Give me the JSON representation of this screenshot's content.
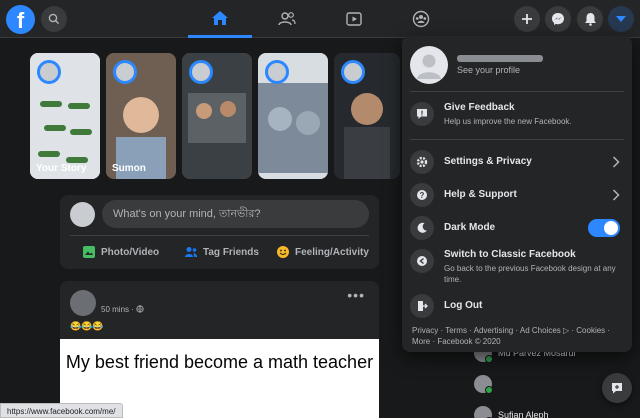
{
  "topbar": {
    "logo_letter": "f"
  },
  "stories": [
    {
      "label": "Your Story",
      "bg": "#e9ebee"
    },
    {
      "label": "Sumon",
      "bg": "#7a6a5a"
    },
    {
      "label": "",
      "bg": "#4a4f55"
    },
    {
      "label": "",
      "bg": "#6b7a8a"
    },
    {
      "label": "",
      "bg": "#2b2e33"
    }
  ],
  "composer": {
    "placeholder": "What's on your mind, তানভীর?",
    "photo_video": "Photo/Video",
    "tag_friends": "Tag Friends",
    "feeling_activity": "Feeling/Activity"
  },
  "post": {
    "time": "50 mins ·",
    "emoji": "😂😂😂",
    "image_text": "My best friend become a math teacher"
  },
  "contacts": [
    {
      "name": "Md Parvez Mosarul"
    },
    {
      "name": ""
    },
    {
      "name": "Sufian Aleph"
    }
  ],
  "menu": {
    "profile_sub": "See your profile",
    "feedback_title": "Give Feedback",
    "feedback_sub": "Help us improve the new Facebook.",
    "settings": "Settings & Privacy",
    "help": "Help & Support",
    "dark_mode": "Dark Mode",
    "dark_mode_on": true,
    "classic_title": "Switch to Classic Facebook",
    "classic_sub": "Go back to the previous Facebook design at any time.",
    "logout": "Log Out",
    "footer": "Privacy · Terms · Advertising · Ad Choices ▷ · Cookies · More · Facebook © 2020"
  },
  "status_url": "https://www.facebook.com/me/",
  "colors": {
    "accent": "#2d88ff",
    "surface": "#242526",
    "background": "#18191a"
  }
}
